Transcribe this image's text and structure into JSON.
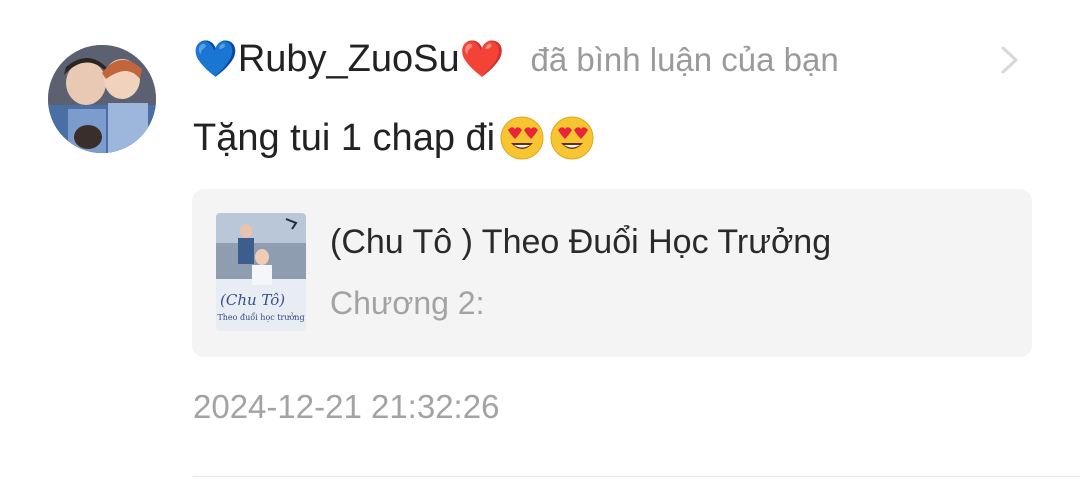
{
  "notification": {
    "user": {
      "prefix_emoji": "💙",
      "name": "Ruby_ZuoSu",
      "suffix_emoji": "❤️",
      "avatar_icon": "user-avatar-photo"
    },
    "action_text": "đã bình luận của bạn",
    "comment": {
      "text": "Tặng tui 1 chap đi",
      "emojis": [
        "😍",
        "😍"
      ]
    },
    "story": {
      "title": "(Chu Tô ) Theo Đuổi Học Trưởng",
      "chapter": "Chương 2:",
      "cover_caption_1": "(Chu Tô)",
      "cover_caption_2": "Theo đuổi học trưởng"
    },
    "timestamp": "2024-12-21 21:32:26",
    "colors": {
      "primary_text": "#222222",
      "secondary_text": "#9a9a9a",
      "card_background": "#f4f4f5",
      "chevron": "#d8d8d8"
    }
  }
}
